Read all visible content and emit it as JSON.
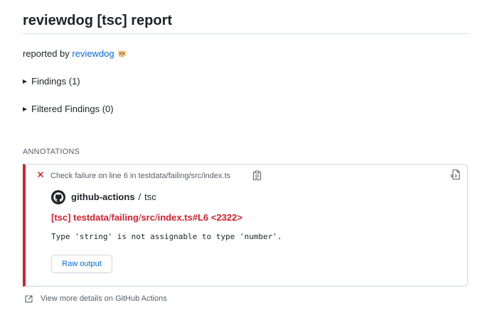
{
  "report": {
    "title": "reviewdog [tsc] report",
    "reported_by_prefix": "reported by ",
    "reported_by_link": "reviewdog",
    "reported_by_icon": "dog-emoji-icon"
  },
  "sections": {
    "findings_label": "Findings (1)",
    "filtered_findings_label": "Filtered Findings (0)"
  },
  "annotations": {
    "heading": "ANNOTATIONS",
    "item": {
      "status_icon": "x-icon",
      "check_line": "Check failure on line 6 in testdata/failing/src/index.ts",
      "source_name": "github-actions",
      "source_sep": "/",
      "source_check": "tsc",
      "title_prefix": "[tsc] testdata",
      "title_part2": "failing",
      "title_part3": "src",
      "title_part4": "index.ts#L6 <2322>",
      "title_slash": "/",
      "message": "Type 'string' is not assignable to type 'number'.",
      "raw_output_label": "Raw output"
    }
  },
  "footer": {
    "more_details_label": "View more details on GitHub Actions"
  },
  "colors": {
    "failure": "#cf222e",
    "link": "#0969da",
    "muted": "#57606a",
    "border": "#d0d7de"
  }
}
